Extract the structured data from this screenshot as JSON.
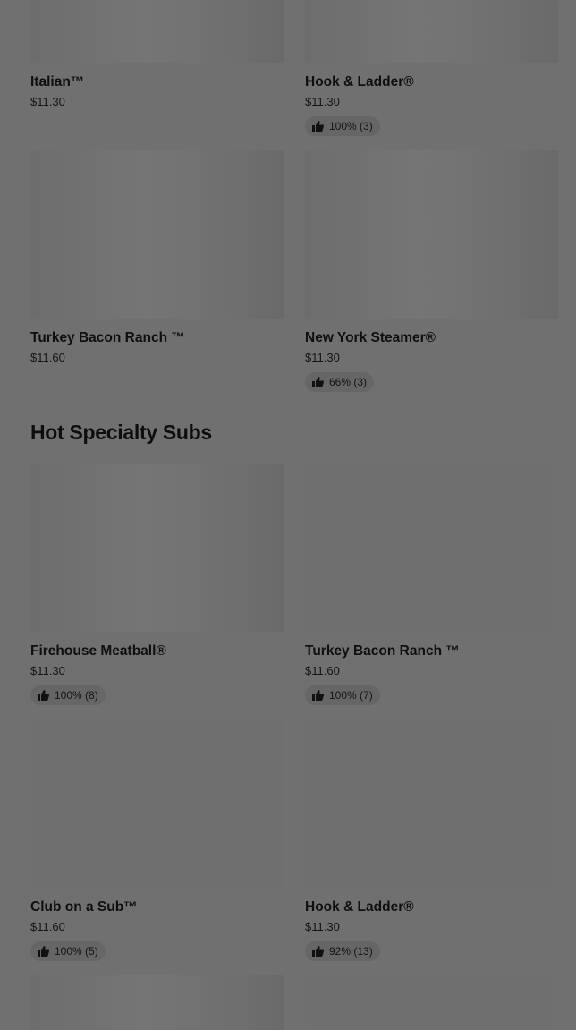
{
  "sections": [
    {
      "items": [
        {
          "name": "Italian™",
          "price": "$11.30",
          "rating": ""
        },
        {
          "name": "Hook & Ladder®",
          "price": "$11.30",
          "rating": "100% (3)"
        },
        {
          "name": "Turkey Bacon Ranch ™",
          "price": "$11.60",
          "rating": ""
        },
        {
          "name": "New York Steamer®",
          "price": "$11.30",
          "rating": "66% (3)"
        }
      ]
    },
    {
      "title": "Hot Specialty Subs",
      "items": [
        {
          "name": "Firehouse Meatball®",
          "price": "$11.30",
          "rating": "100% (8)"
        },
        {
          "name": "Turkey Bacon Ranch ™",
          "price": "$11.60",
          "rating": "100% (7)"
        },
        {
          "name": "Club on a Sub™",
          "price": "$11.60",
          "rating": "100% (5)"
        },
        {
          "name": "Hook & Ladder®",
          "price": "$11.30",
          "rating": "92% (13)"
        }
      ]
    }
  ],
  "icons": {
    "rating": "thumbs-up-icon"
  },
  "colors": {
    "overlay": "#707070",
    "badge": "#666666",
    "text": "#111111"
  }
}
